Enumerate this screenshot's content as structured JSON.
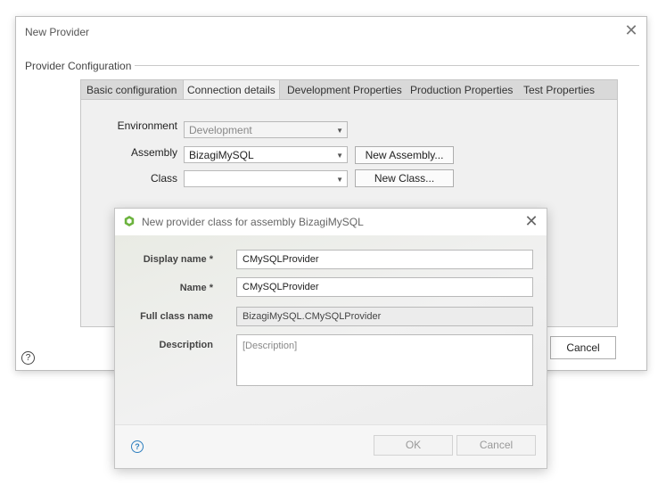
{
  "outer": {
    "title": "New Provider",
    "group_label": "Provider Configuration",
    "tabs": [
      {
        "label": "Basic configuration"
      },
      {
        "label": "Connection details"
      },
      {
        "label": "Development Properties"
      },
      {
        "label": "Production Properties"
      },
      {
        "label": "Test Properties"
      }
    ],
    "active_tab": "Connection details",
    "environment": {
      "label": "Environment",
      "value": "Development"
    },
    "assembly": {
      "label": "Assembly",
      "value": "BizagiMySQL"
    },
    "class": {
      "label": "Class",
      "value": ""
    },
    "new_assembly_label": "New Assembly...",
    "new_class_label": "New Class...",
    "cancel_label": "Cancel",
    "help_glyph": "?"
  },
  "inner": {
    "title": "New provider class for assembly BizagiMySQL",
    "display_name": {
      "label": "Display name *",
      "value": "CMySQLProvider"
    },
    "name": {
      "label": "Name *",
      "value": "CMySQLProvider"
    },
    "full_class_name": {
      "label": "Full class name",
      "value": "BizagiMySQL.CMySQLProvider"
    },
    "description": {
      "label": "Description",
      "placeholder": "[Description]"
    },
    "ok_label": "OK",
    "cancel_label": "Cancel",
    "help_glyph": "?"
  },
  "colors": {
    "logo_green": "#6cb33e",
    "help_blue": "#2e7fbf"
  },
  "icons": {
    "close": "close-icon",
    "dropdown": "chevron-down-icon",
    "logo": "bizagi-logo-icon",
    "help": "help-icon"
  }
}
